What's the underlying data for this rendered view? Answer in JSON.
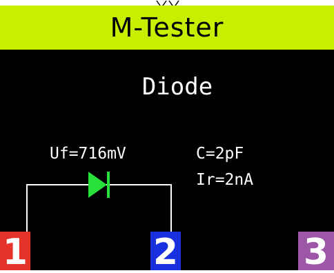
{
  "app": {
    "title": "M-Tester"
  },
  "measurement": {
    "mode": "Diode",
    "forward_voltage": "Uf=716mV",
    "capacitance": "C=2pF",
    "reverse_current": "Ir=2nA"
  },
  "pins": {
    "pin1": {
      "label": "1",
      "color": "#e53329"
    },
    "pin2": {
      "label": "2",
      "color": "#1830e0"
    },
    "pin3": {
      "label": "3",
      "color": "#9c57a6"
    }
  },
  "colors": {
    "title_bar": "#c7ef00",
    "diode": "#27e23a",
    "background": "#000000"
  }
}
